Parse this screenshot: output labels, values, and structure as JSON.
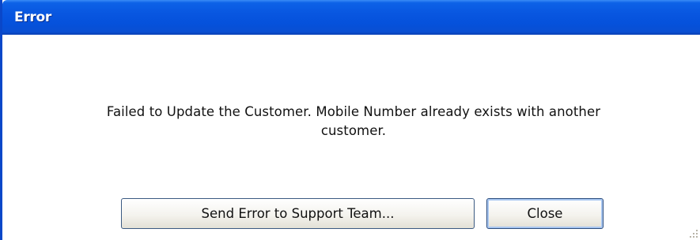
{
  "dialog": {
    "title": "Error",
    "message_line1": "Failed to Update the Customer. Mobile Number already exists with another",
    "message_line2": "customer."
  },
  "buttons": {
    "send_label": "Send Error to Support Team...",
    "close_label": "Close"
  },
  "colors": {
    "title_bar": "#0856e0",
    "title_text": "#ffffff",
    "background": "#ffffff"
  },
  "icons": {
    "resize_grip": "resize-grip-icon"
  }
}
